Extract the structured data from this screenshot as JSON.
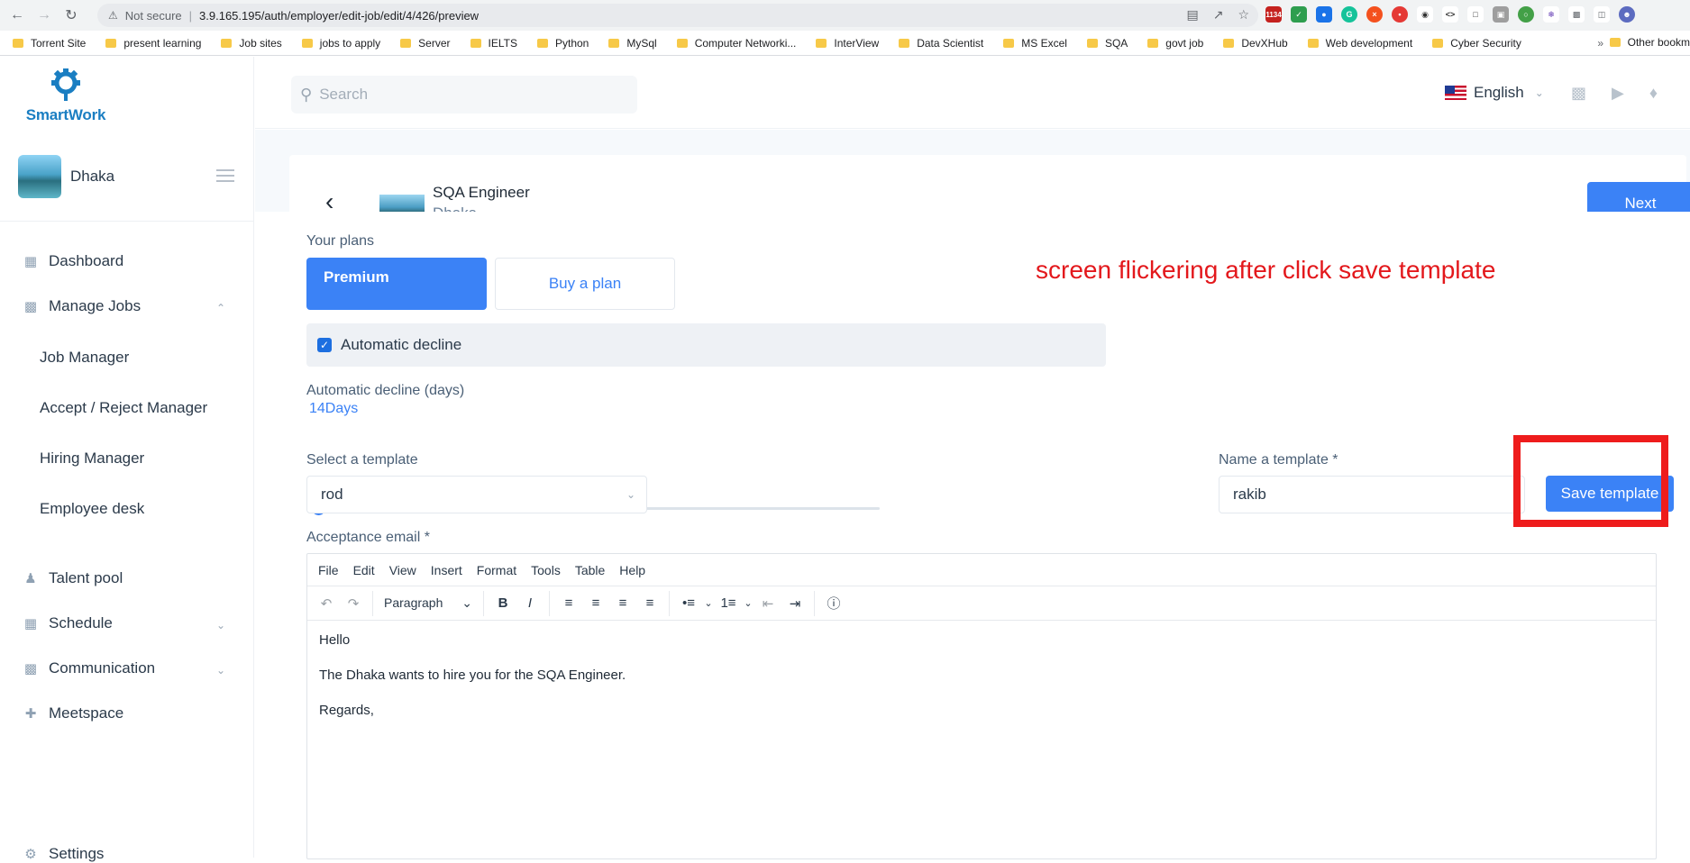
{
  "browser": {
    "security_label": "Not secure",
    "url": "3.9.165.195/auth/employer/edit-job/edit/4/426/preview",
    "mail_badge": "1134",
    "bookmarks": [
      "Torrent Site",
      "present learning",
      "Job sites",
      "jobs to apply",
      "Server",
      "IELTS",
      "Python",
      "MySql",
      "Computer Networki...",
      "InterView",
      "Data Scientist",
      "MS Excel",
      "SQA",
      "govt job",
      "DevXHub",
      "Web development",
      "Cyber Security"
    ],
    "bookmarks_overflow": "»",
    "other_bookmarks": "Other bookm"
  },
  "app": {
    "logo_text": "SmartWork",
    "profile_name": "Dhaka",
    "search_placeholder": "Search",
    "language": "English"
  },
  "sidebar": {
    "dashboard": "Dashboard",
    "manage_jobs": "Manage Jobs",
    "job_manager": "Job Manager",
    "accept_reject": "Accept / Reject Manager",
    "hiring_manager": "Hiring Manager",
    "employee_desk": "Employee desk",
    "talent_pool": "Talent pool",
    "schedule": "Schedule",
    "communication": "Communication",
    "meetspace": "Meetspace",
    "settings": "Settings"
  },
  "job": {
    "title": "SQA Engineer",
    "company": "Dhaka",
    "next_label": "Next"
  },
  "form": {
    "plans_label": "Your plans",
    "plan_premium": "Premium",
    "plan_buy": "Buy a plan",
    "auto_decline_label": "Automatic decline",
    "auto_decline_checked": true,
    "auto_decline_days_label": "Automatic decline (days)",
    "auto_decline_days_value": "14Days",
    "slider_fraction": 0.0,
    "select_template_label": "Select a template",
    "selected_template": "rod",
    "name_template_label": "Name a template *",
    "template_name_value": "rakib",
    "save_template_label": "Save template",
    "acceptance_email_label": "Acceptance email *"
  },
  "annotation": {
    "text": "screen flickering after click save template",
    "color": "#e3181c"
  },
  "editor": {
    "menus": [
      "File",
      "Edit",
      "View",
      "Insert",
      "Format",
      "Tools",
      "Table",
      "Help"
    ],
    "block_format": "Paragraph",
    "body": [
      "Hello",
      "The Dhaka wants to hire you for the SQA Engineer.",
      "Regards,"
    ]
  }
}
